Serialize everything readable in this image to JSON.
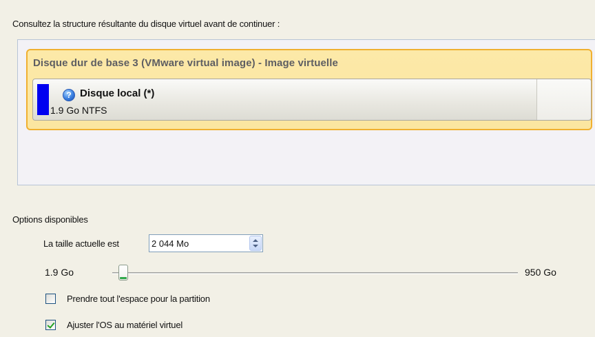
{
  "instruction": "Consultez la structure résultante du disque virtuel avant de continuer :",
  "disk": {
    "title": "Disque dur de base 3 (VMware virtual image) - Image virtuelle",
    "partition": {
      "icon": "question-icon",
      "icon_glyph": "?",
      "name": "Disque local (*)",
      "size_fs": "1.9 Go NTFS",
      "color": "#0000f0"
    }
  },
  "options": {
    "header": "Options disponibles",
    "size_label": "La taille actuelle est",
    "size_value": "2 044 Mo",
    "slider": {
      "min_label": "1.9 Go",
      "max_label": "950 Go",
      "value_fraction": 0.0
    },
    "take_all_space": {
      "label": "Prendre tout l'espace pour la partition",
      "checked": false
    },
    "adjust_os": {
      "label": "Ajuster l'OS au matériel virtuel",
      "checked": true
    }
  },
  "colors": {
    "disk_highlight": "#f0b030",
    "disk_fill": "#fce9a8",
    "window_bg": "#f2f0e6"
  }
}
